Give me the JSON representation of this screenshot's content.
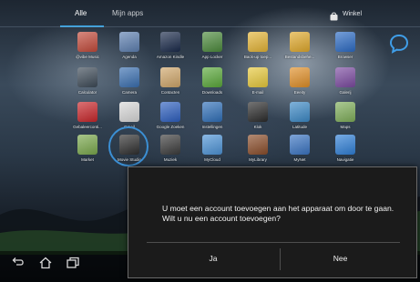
{
  "tabs": [
    {
      "label": "Alle",
      "selected": true
    },
    {
      "label": "Mijn apps",
      "selected": false
    }
  ],
  "store_label": "Winkel",
  "apps": [
    {
      "label": "@vibe Music",
      "icon": "vibe-music-icon",
      "color": "#c24a3a"
    },
    {
      "label": "Agenda",
      "icon": "calendar-icon",
      "color": "#5d7fb0"
    },
    {
      "label": "Amazon Kindle",
      "icon": "kindle-icon",
      "color": "#1a2a4a"
    },
    {
      "label": "App Locker",
      "icon": "lock-icon",
      "color": "#4c8a3c"
    },
    {
      "label": "Back-up toep...",
      "icon": "backup-icon",
      "color": "#e4b436"
    },
    {
      "label": "Bestandsbehe...",
      "icon": "folder-icon",
      "color": "#e0a92c"
    },
    {
      "label": "Browser",
      "icon": "globe-icon",
      "color": "#2c6bc4"
    },
    {
      "label": "Calculator",
      "icon": "calculator-icon",
      "color": "#3d4a57"
    },
    {
      "label": "Camera",
      "icon": "camera-icon",
      "color": "#3a6fb0"
    },
    {
      "label": "Contacten",
      "icon": "contacts-icon",
      "color": "#cfa66a"
    },
    {
      "label": "Downloads",
      "icon": "download-icon",
      "color": "#5aa83a"
    },
    {
      "label": "E-mail",
      "icon": "email-icon",
      "color": "#e7c93c"
    },
    {
      "label": "Eeeity",
      "icon": "sync-icon",
      "color": "#e08f28"
    },
    {
      "label": "Galerij",
      "icon": "gallery-icon",
      "color": "#7b4aa0"
    },
    {
      "label": "Gebaleerconti...",
      "icon": "alert-icon",
      "color": "#c8262a"
    },
    {
      "label": "Gmail",
      "icon": "gmail-icon",
      "color": "#d8d8d8"
    },
    {
      "label": "Google Zoeken",
      "icon": "google-search-icon",
      "color": "#2d5fbf"
    },
    {
      "label": "Instellingen",
      "icon": "settings-icon",
      "color": "#2f6fb8"
    },
    {
      "label": "Klok",
      "icon": "clock-icon",
      "color": "#2b2b2b"
    },
    {
      "label": "Latitude",
      "icon": "latitude-icon",
      "color": "#3c89c6"
    },
    {
      "label": "Maps",
      "icon": "maps-icon",
      "color": "#7fae5a"
    },
    {
      "label": "Market",
      "icon": "market-icon",
      "color": "#7aa84c"
    },
    {
      "label": "Movie Studio",
      "icon": "movie-studio-icon",
      "color": "#2e2e2e"
    },
    {
      "label": "Muziek",
      "icon": "music-icon",
      "color": "#3b3b3b"
    },
    {
      "label": "MyCloud",
      "icon": "cloud-icon",
      "color": "#4d93d6"
    },
    {
      "label": "MyLibrary",
      "icon": "library-icon",
      "color": "#8a4d2a"
    },
    {
      "label": "MyNet",
      "icon": "network-icon",
      "color": "#3a74c2"
    },
    {
      "label": "Navigatie",
      "icon": "navigation-icon",
      "color": "#2f7fd6"
    }
  ],
  "dialog": {
    "message": "U moet een account toevoegen aan het apparaat om door te gaan. Wilt u nu een account toevoegen?",
    "confirm_label": "Ja",
    "cancel_label": "Nee"
  },
  "navigation": [
    {
      "icon": "back-icon"
    },
    {
      "icon": "home-icon"
    },
    {
      "icon": "recent-apps-icon"
    }
  ]
}
